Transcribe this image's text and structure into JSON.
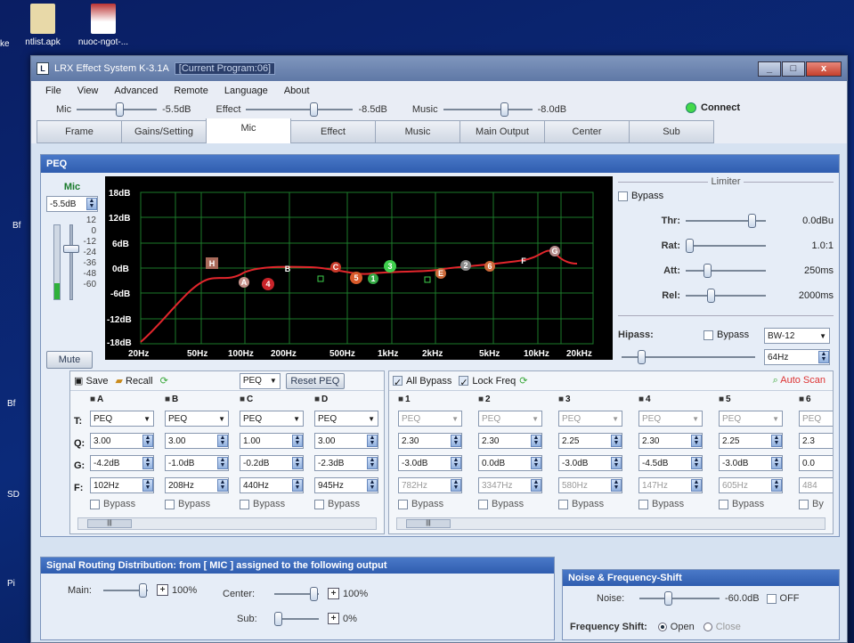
{
  "desktop": {
    "icons": [
      {
        "label": "ntlist.apk"
      },
      {
        "label": "nuoc-ngot-..."
      }
    ],
    "left_fragments": [
      "ke",
      "Bf",
      "Bf",
      "SD",
      "Pi"
    ]
  },
  "window": {
    "title": "LRX Effect System K-3.1A",
    "program": "[Current Program:06]",
    "buttons": [
      "_",
      "□",
      "x"
    ]
  },
  "menu": [
    "File",
    "View",
    "Advanced",
    "Remote",
    "Language",
    "About"
  ],
  "levels": [
    {
      "label": "Mic",
      "value": "-5.5dB"
    },
    {
      "label": "Effect",
      "value": "-8.5dB"
    },
    {
      "label": "Music",
      "value": "-8.0dB"
    }
  ],
  "connect": "Connect",
  "tabs": [
    "Frame",
    "Gains/Setting",
    "Mic",
    "Effect",
    "Music",
    "Main Output",
    "Center",
    "Sub"
  ],
  "active_tab": "Mic",
  "peq": {
    "title": "PEQ",
    "mic_label": "Mic",
    "mic_value": "-5.5dB",
    "meter_scale": [
      "12",
      "0",
      "-12",
      "-24",
      "-36",
      "-48",
      "-60"
    ],
    "mute": "Mute"
  },
  "graph": {
    "y_labels": [
      "18dB",
      "12dB",
      "6dB",
      "0dB",
      "-6dB",
      "-12dB",
      "-18dB"
    ],
    "x_labels": [
      "20Hz",
      "50Hz",
      "100Hz",
      "200Hz",
      "500Hz",
      "1kHz",
      "2kHz",
      "5kHz",
      "10kHz",
      "20kHz"
    ],
    "markers": [
      "H",
      "A",
      "4",
      "B",
      "C",
      "5",
      "1",
      "3",
      "E",
      "2",
      "6",
      "F",
      "G"
    ]
  },
  "limiter": {
    "title": "Limiter",
    "bypass": "Bypass",
    "rows": [
      {
        "name": "Thr:",
        "value": "0.0dBu"
      },
      {
        "name": "Rat:",
        "value": "1.0:1"
      },
      {
        "name": "Att:",
        "value": "250ms"
      },
      {
        "name": "Rel:",
        "value": "2000ms"
      }
    ]
  },
  "hipass": {
    "label": "Hipass:",
    "bypass": "Bypass",
    "type": "BW-12",
    "freq": "64Hz"
  },
  "peq_left": {
    "save": "Save",
    "recall": "Recall",
    "mode": "PEQ",
    "reset": "Reset PEQ",
    "row_labels": [
      "T:",
      "Q:",
      "G:",
      "F:"
    ],
    "channels": [
      {
        "name": "A",
        "type": "PEQ",
        "q": "3.00",
        "g": "-4.2dB",
        "f": "102Hz",
        "bypass": "Bypass"
      },
      {
        "name": "B",
        "type": "PEQ",
        "q": "3.00",
        "g": "-1.0dB",
        "f": "208Hz",
        "bypass": "Bypass"
      },
      {
        "name": "C",
        "type": "PEQ",
        "q": "1.00",
        "g": "-0.2dB",
        "f": "440Hz",
        "bypass": "Bypass"
      },
      {
        "name": "D",
        "type": "PEQ",
        "q": "3.00",
        "g": "-2.3dB",
        "f": "945Hz",
        "bypass": "Bypass"
      }
    ]
  },
  "peq_right": {
    "all_bypass": "All Bypass",
    "lock_freq": "Lock Freq",
    "auto_scan": "Auto Scan",
    "channels": [
      {
        "name": "1",
        "type": "PEQ",
        "q": "2.30",
        "g": "-3.0dB",
        "f": "782Hz",
        "bypass": "Bypass"
      },
      {
        "name": "2",
        "type": "PEQ",
        "q": "2.30",
        "g": "0.0dB",
        "f": "3347Hz",
        "bypass": "Bypass"
      },
      {
        "name": "3",
        "type": "PEQ",
        "q": "2.25",
        "g": "-3.0dB",
        "f": "580Hz",
        "bypass": "Bypass"
      },
      {
        "name": "4",
        "type": "PEQ",
        "q": "2.30",
        "g": "-4.5dB",
        "f": "147Hz",
        "bypass": "Bypass"
      },
      {
        "name": "5",
        "type": "PEQ",
        "q": "2.25",
        "g": "-3.0dB",
        "f": "605Hz",
        "bypass": "Bypass"
      },
      {
        "name": "6",
        "type": "PEQ",
        "q": "2.3",
        "g": "0.0",
        "f": "484",
        "bypass": "By"
      }
    ]
  },
  "routing": {
    "title": "Signal Routing Distribution: from [ MIC ] assigned to the following output",
    "main_label": "Main:",
    "main_value": "100%",
    "center_label": "Center:",
    "center_value": "100%",
    "sub_label": "Sub:",
    "sub_value": "0%"
  },
  "noise": {
    "title": "Noise & Frequency-Shift",
    "noise_label": "Noise:",
    "noise_value": "-60.0dB",
    "off": "OFF",
    "fs_label": "Frequency Shift:",
    "open": "Open",
    "close": "Close"
  }
}
